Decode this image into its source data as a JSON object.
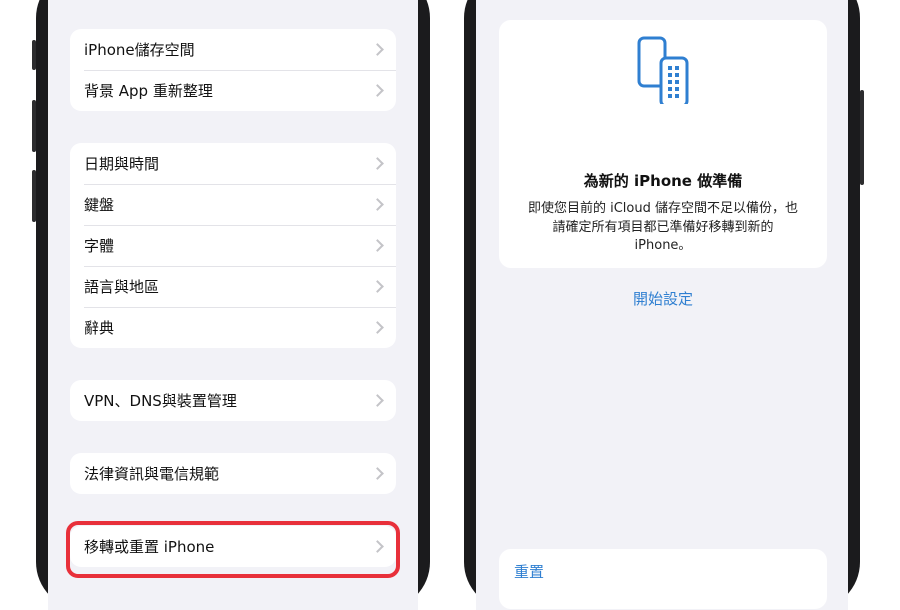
{
  "left_screen": {
    "group1": [
      {
        "label": "iPhone儲存空間"
      },
      {
        "label": "背景 App 重新整理"
      }
    ],
    "group2": [
      {
        "label": "日期與時間"
      },
      {
        "label": "鍵盤"
      },
      {
        "label": "字體"
      },
      {
        "label": "語言與地區"
      },
      {
        "label": "辭典"
      }
    ],
    "group3": [
      {
        "label": "VPN、DNS與裝置管理"
      }
    ],
    "group4": [
      {
        "label": "法律資訊與電信規範"
      }
    ],
    "group5": [
      {
        "label": "移轉或重置 iPhone"
      }
    ],
    "highlight_color": "#e8303a"
  },
  "right_screen": {
    "prepare_card": {
      "icon": "two-phones-icon",
      "title": "為新的 iPhone 做準備",
      "body_lines": [
        "即使您目前的 iCloud 儲存空間不足以備份，也",
        "請確定所有項目都已準備好移轉到新的",
        "iPhone。"
      ],
      "action_label": "開始設定"
    },
    "reset_label": "重置"
  },
  "colors": {
    "accent": "#2f7fd1",
    "screen_background": "#f2f2f7",
    "phone_frame": "#1b1b1d"
  }
}
